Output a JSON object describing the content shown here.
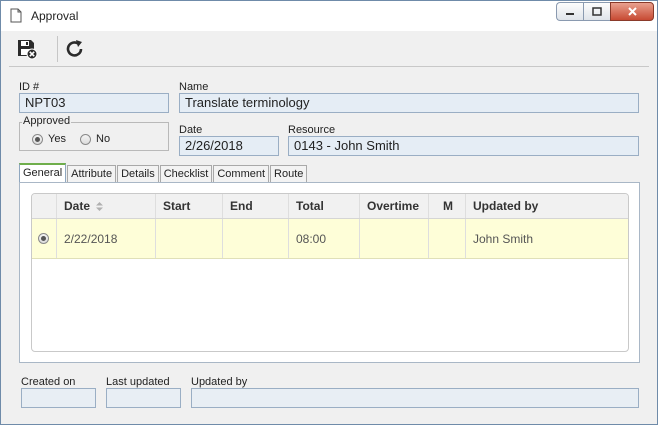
{
  "window": {
    "title": "Approval"
  },
  "toolbar": {
    "save_close_icon": "save-close-icon",
    "refresh_icon": "refresh-icon"
  },
  "header": {
    "id_label": "ID #",
    "id_value": "NPT03",
    "name_label": "Name",
    "name_value": "Translate terminology",
    "approved_label": "Approved",
    "approved_options": [
      "Yes",
      "No"
    ],
    "approved_selected": "Yes",
    "date_label": "Date",
    "date_value": "2/26/2018",
    "resource_label": "Resource",
    "resource_value": "0143 - John Smith"
  },
  "tabs": [
    "General",
    "Attribute",
    "Details",
    "Checklist",
    "Comment",
    "Route"
  ],
  "active_tab": "General",
  "grid": {
    "columns": [
      "",
      "Date",
      "Start",
      "End",
      "Total",
      "Overtime",
      "M",
      "Updated by"
    ],
    "rows": [
      {
        "date": "2/22/2018",
        "start": "",
        "end": "",
        "total": "08:00",
        "overtime": "",
        "m": "",
        "updated_by": "John Smith"
      }
    ]
  },
  "footer": {
    "created_on_label": "Created on",
    "created_on_value": "",
    "last_updated_label": "Last updated",
    "last_updated_value": "",
    "updated_by_label": "Updated by",
    "updated_by_value": ""
  },
  "colors": {
    "field_bg": "#e5edf5",
    "row_highlight": "#fefed8",
    "active_tab_accent": "#6fae4b",
    "close_button": "#c74a33"
  }
}
